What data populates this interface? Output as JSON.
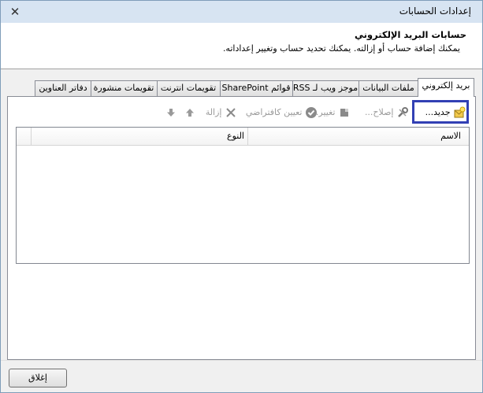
{
  "window": {
    "title": "إعدادات الحسابات"
  },
  "header": {
    "title": "حسابات البريد الإلكتروني",
    "subtitle": "يمكنك إضافة حساب أو إزالته. يمكنك تحديد حساب وتغيير إعداداته."
  },
  "tabs": [
    {
      "label": "بريد إلكتروني",
      "active": true
    },
    {
      "label": "ملفات البيانات"
    },
    {
      "label": "موجز ويب لـ RSS"
    },
    {
      "label": "قوائم SharePoint"
    },
    {
      "label": "تقويمات انترنت"
    },
    {
      "label": "تقويمات منشورة"
    },
    {
      "label": "دفاتر العناوين"
    }
  ],
  "toolbar": {
    "new": "جديد...",
    "repair": "إصلاح...",
    "change": "تغيير...",
    "set_default": "تعيين كافتراضي",
    "remove": "إزالة"
  },
  "list": {
    "columns": {
      "name": "الاسم",
      "type": "النوع"
    },
    "rows": []
  },
  "footer": {
    "close": "إغلاق"
  },
  "colors": {
    "highlight": "#3240b4",
    "titlebar": "#d7e4f2"
  }
}
